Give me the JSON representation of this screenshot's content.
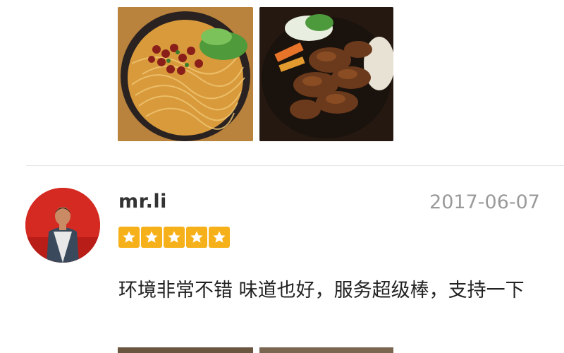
{
  "review": {
    "username": "mr.li",
    "date": "2017-06-07",
    "rating": 5,
    "text": "环境非常不错  味道也好，服务超级棒，支持一下"
  },
  "colors": {
    "star": "#f6b019",
    "avatar_bg": "#d42a22",
    "date": "#9a9a9a"
  },
  "icons": [
    "star-icon"
  ]
}
